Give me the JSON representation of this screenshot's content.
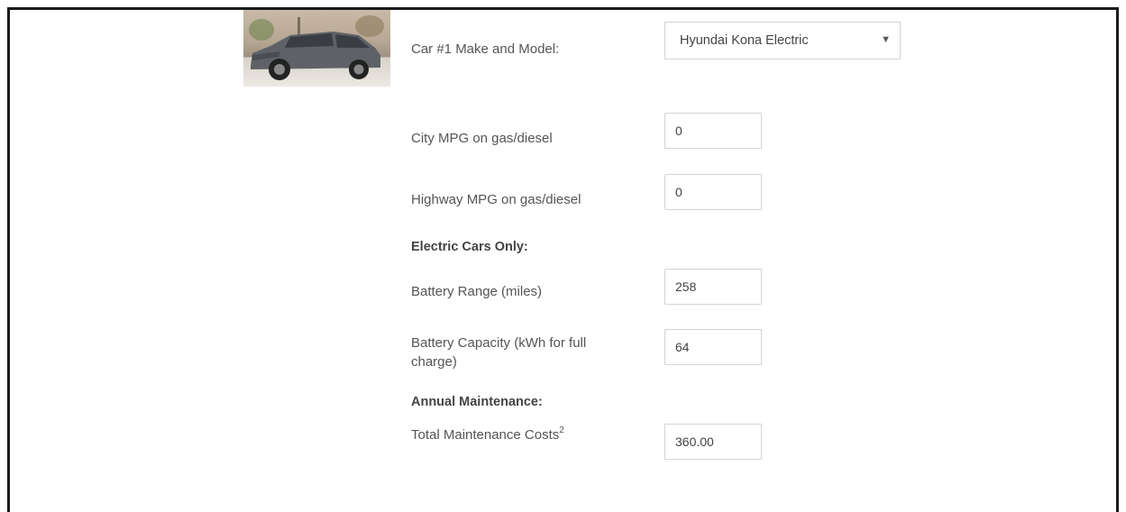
{
  "car_image": {
    "alt": "Hyundai Kona Electric"
  },
  "make_model": {
    "label": "Car #1 Make and Model:",
    "selected": "Hyundai Kona Electric"
  },
  "city_mpg": {
    "label": "City MPG on gas/diesel",
    "value": "0"
  },
  "highway_mpg": {
    "label": "Highway MPG on gas/diesel",
    "value": "0"
  },
  "electric_section": {
    "heading": "Electric Cars Only:"
  },
  "battery_range": {
    "label": "Battery Range (miles)",
    "value": "258"
  },
  "battery_capacity": {
    "label_line1": "Battery Capacity (kWh for full",
    "label_line2": "charge)",
    "value": "64"
  },
  "maintenance_section": {
    "heading": "Annual Maintenance:"
  },
  "maintenance_costs": {
    "label": "Total Maintenance Costs",
    "footnote": "2",
    "value": "360.00"
  },
  "icons": {
    "dropdown": "caret-down-icon"
  },
  "colors": {
    "frame": "#1a1a1a",
    "text": "#555555",
    "border": "#d4d4d4"
  }
}
